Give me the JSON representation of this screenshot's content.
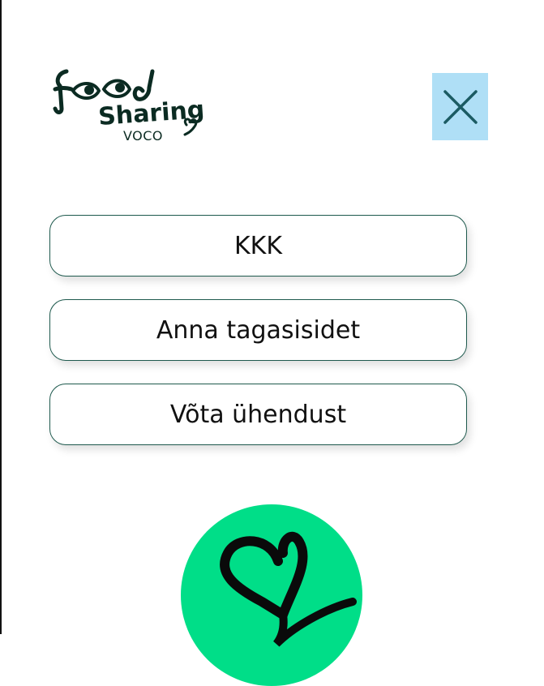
{
  "header": {
    "logo_text_line1": "food",
    "logo_text_line2": "Sharing",
    "logo_sub": "VOCO",
    "close_icon": "close-icon"
  },
  "menu": {
    "items": [
      {
        "label": "KKK"
      },
      {
        "label": "Anna tagasisidet"
      },
      {
        "label": "Võta ühendust"
      }
    ]
  },
  "colors": {
    "accent_green": "#00de88",
    "border_green": "#1f5a4e",
    "close_bg": "#afdff6",
    "logo_dark": "#0b2b22"
  }
}
